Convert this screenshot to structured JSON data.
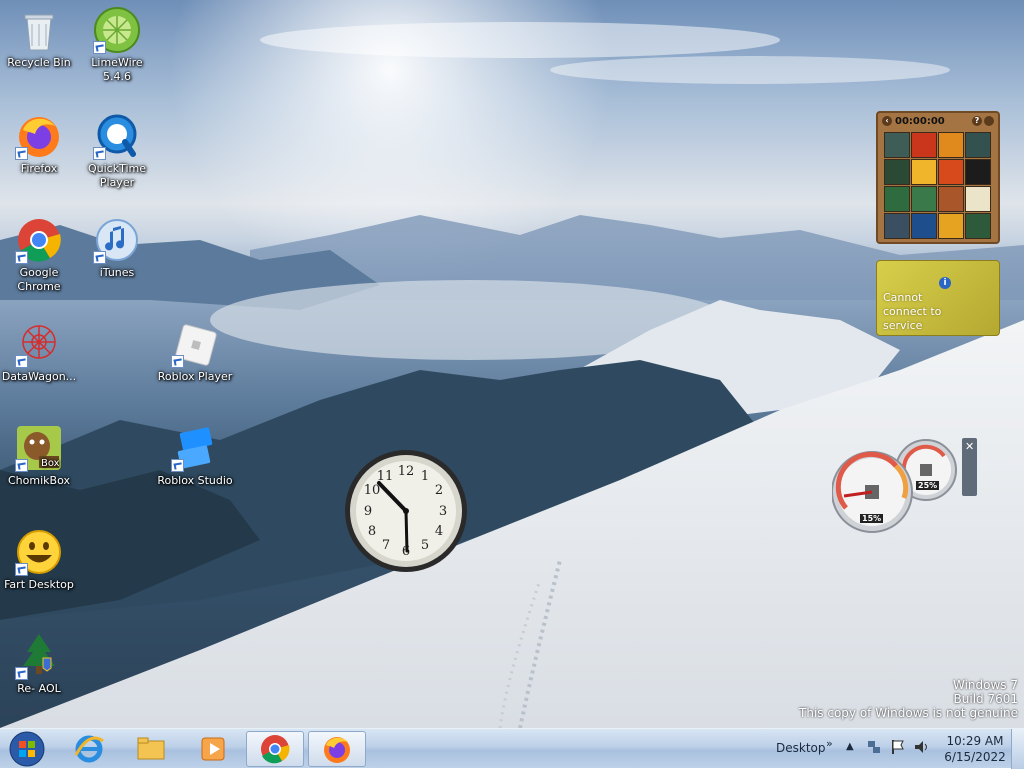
{
  "desktop": {
    "icons": [
      {
        "label": "Recycle Bin",
        "icon": "recycle-bin-icon"
      },
      {
        "label": "LimeWire\n5.4.6",
        "icon": "limewire-icon"
      },
      {
        "label": "Firefox",
        "icon": "firefox-icon"
      },
      {
        "label": "QuickTime\nPlayer",
        "icon": "quicktime-icon"
      },
      {
        "label": "Google\nChrome",
        "icon": "chrome-icon"
      },
      {
        "label": "iTunes",
        "icon": "itunes-icon"
      },
      {
        "label": "DataWagon...",
        "icon": "datawagon-icon"
      },
      {
        "label": "Roblox Player",
        "icon": "roblox-player-icon"
      },
      {
        "label": "ChomikBox",
        "icon": "chomikbox-icon"
      },
      {
        "label": "Roblox Studio",
        "icon": "roblox-studio-icon"
      },
      {
        "label": "Fart Desktop",
        "icon": "smiley-icon"
      },
      {
        "label": "Re- AOL",
        "icon": "aol-tree-icon"
      }
    ]
  },
  "gadgets": {
    "puzzle": {
      "time": "00:00:00"
    },
    "feed": {
      "message": "Cannot connect to service"
    },
    "clock": {
      "numbers": [
        "12",
        "1",
        "2",
        "3",
        "4",
        "5",
        "6",
        "7",
        "8",
        "9",
        "10",
        "11"
      ]
    },
    "cpu_meter": {
      "cpu_percent": "15%",
      "memory_percent": "25%"
    }
  },
  "watermark": {
    "line1": "Windows 7",
    "line2": "Build 7601",
    "line3": "This copy of Windows is not genuine"
  },
  "taskbar": {
    "desktop_label": "Desktop",
    "time": "10:29 AM",
    "date": "6/15/2022"
  },
  "colors": {
    "accent": "#2a66c6",
    "taskbar": "#bcd0e8"
  }
}
